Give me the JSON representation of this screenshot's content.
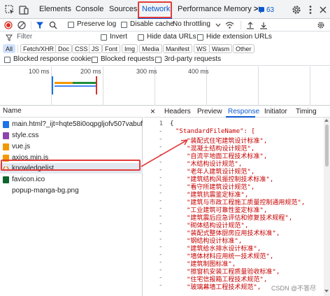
{
  "tabs": {
    "items": [
      "Elements",
      "Console",
      "Sources",
      "Network",
      "Performance",
      "Memory"
    ],
    "more": ">>",
    "issues_badge": "63"
  },
  "toolbar": {
    "preserve_log": "Preserve log",
    "disable_cache": "Disable cache",
    "throttling": "No throttling"
  },
  "filter": {
    "placeholder": "Filter",
    "invert": "Invert",
    "hide_data_urls": "Hide data URLs",
    "hide_extension_urls": "Hide extension URLs"
  },
  "type_filters": [
    "All",
    "Fetch/XHR",
    "Doc",
    "CSS",
    "JS",
    "Font",
    "Img",
    "Media",
    "Manifest",
    "WS",
    "Wasm",
    "Other"
  ],
  "blocked": {
    "blocked_response_cookies": "Blocked response cookies",
    "blocked_requests": "Blocked requests",
    "third_party_requests": "3rd-party requests"
  },
  "timeline": {
    "labels": [
      "100 ms",
      "200 ms",
      "300 ms",
      "400 ms"
    ]
  },
  "requests": {
    "header": "Name",
    "rows": [
      {
        "name": "main.html?_ijt=hqte58i0oqpgljofv507vabufh",
        "type": "doc",
        "color": "#1a73e8"
      },
      {
        "name": "style.css",
        "type": "css",
        "color": "#8e44ad"
      },
      {
        "name": "vue.js",
        "type": "js",
        "color": "#f29900"
      },
      {
        "name": "axios.min.js",
        "type": "js",
        "color": "#f29900"
      },
      {
        "name": "knowledgelist",
        "type": "xhr",
        "color": "#e37400"
      },
      {
        "name": "favicon.ico",
        "type": "img",
        "color": "#0d652d"
      },
      {
        "name": "popup-manga-bg.png",
        "type": "img",
        "color": "#5f6368"
      }
    ]
  },
  "details": {
    "close": "×",
    "tabs": [
      "Headers",
      "Preview",
      "Response",
      "Initiator",
      "Timing"
    ],
    "active_tab": "Response"
  },
  "response": {
    "line_numbers": [
      "1",
      "-",
      "-",
      "-",
      "-",
      "-",
      "-",
      "-",
      "-",
      "-",
      "-",
      "-",
      "-",
      "-",
      "-",
      "-",
      "-",
      "-",
      "-",
      "-",
      "-",
      "-"
    ],
    "open_brace": "{",
    "key_line": "\"StandardFileName\": [",
    "items": [
      "\"装配式住宅建筑设计标准\",",
      "\"混凝土结构设计规范\",",
      "\"自流平地面工程技术标准\",",
      "\"木结构设计规范\",",
      "\"老年人建筑设计规范\",",
      "\"建筑结构风振控制技术标准\",",
      "\"看守所建筑设计规范\",",
      "\"建筑抗震鉴定标准\",",
      "\"建筑与市政工程施工质量控制通用规范\",",
      "\"工业建筑可靠性鉴定标准\",",
      "\"建筑震后应急评估和修复技术规程\",",
      "\"砌体结构设计规范\",",
      "\"装配式整体厨房应用技术标准\",",
      "\"钢结构设计标准\",",
      "\"建筑给水排水设计标准\",",
      "\"墙体材料应用统一技术规范\",",
      "\"建筑制图标准\",",
      "\"擦窗机安装工程质量验收标准\",",
      "\"住宅信报箱工程技术规范\",",
      "\"玻璃幕墙工程技术规范\","
    ]
  },
  "watermark": "CSDN @不答尽",
  "colors": {
    "accent": "#0b57d0",
    "annotation_red": "#e23b3b",
    "string_red": "#c80000"
  }
}
